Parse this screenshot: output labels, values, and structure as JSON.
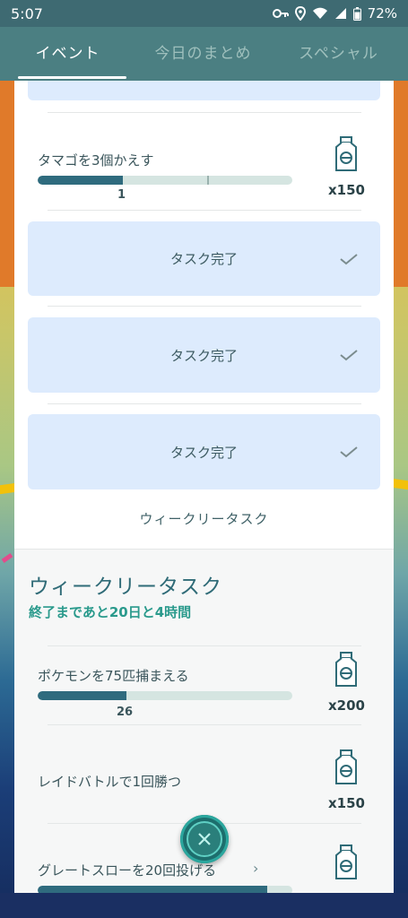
{
  "statusbar": {
    "time": "5:07",
    "battery": "72%"
  },
  "tabs": [
    {
      "label": "イベント"
    },
    {
      "label": "今日のまとめ"
    },
    {
      "label": "スペシャル"
    }
  ],
  "tasks_top": [
    {
      "title": "タマゴを3個かえす",
      "progress_value": "1",
      "progress_fraction": 0.333,
      "reward_qty": "x150"
    }
  ],
  "completed": [
    {
      "label": "タスク完了"
    },
    {
      "label": "タスク完了"
    },
    {
      "label": "タスク完了"
    }
  ],
  "section_link": "ウィークリータスク",
  "weekly": {
    "heading": "ウィークリータスク",
    "remaining": "終了まであと20日と4時間",
    "tasks": [
      {
        "title": "ポケモンを75匹捕まえる",
        "progress_value": "26",
        "progress_fraction": 0.347,
        "reward_qty": "x200"
      },
      {
        "title": "レイドバトルで1回勝つ",
        "reward_qty": "x150"
      },
      {
        "title": "グレートスローを20回投げる",
        "progress_fraction": 0.9
      }
    ]
  },
  "colors": {
    "accent": "#2f6b7e",
    "tab_bar": "#4b7f82",
    "complete_box": "#ddebfd",
    "remaining_text": "#2a9a8c"
  }
}
